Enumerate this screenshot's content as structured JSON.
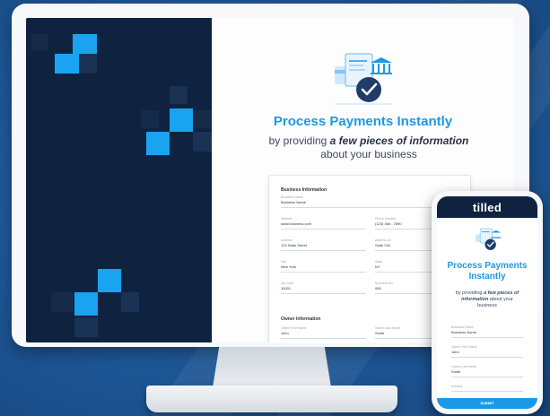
{
  "colors": {
    "accent": "#1a9ae6",
    "brand_dark": "#0f2340",
    "brand_square": "#1aa3f0",
    "background": "#1f5a9c"
  },
  "desktop": {
    "headline": "Process Payments Instantly",
    "sub_prefix": "by providing ",
    "sub_emphasis": "a few pieces of information",
    "sub_suffix": " about your business",
    "icon": "payments-illustration-icon",
    "form": {
      "business_section": "Business Information",
      "owner_section": "Owner Information",
      "fields": [
        {
          "label": "Business Name",
          "value": "Business Name"
        },
        {
          "label": "Website",
          "value": "www.business.com"
        },
        {
          "label": "Phone Number",
          "value": "(123) 456 - 7890"
        },
        {
          "label": "Address",
          "value": "123 State Street"
        },
        {
          "label": "Address #2",
          "value": "Suite 234"
        },
        {
          "label": "City",
          "value": "New York"
        },
        {
          "label": "State",
          "value": "NY"
        },
        {
          "label": "Zip Code",
          "value": "10001"
        },
        {
          "label": "Business Ein",
          "value": "085"
        },
        {
          "label": "Owner First Name",
          "value": "John"
        },
        {
          "label": "Owner Last Name",
          "value": "Smith"
        }
      ]
    }
  },
  "mobile": {
    "logo": "tilled",
    "headline": "Process Payments Instantly",
    "sub_prefix": "by providing ",
    "sub_emphasis": "a few pieces of information",
    "sub_suffix": " about your business",
    "icon": "payments-illustration-icon",
    "fields": [
      {
        "label": "Business Name",
        "value": "Business Name"
      },
      {
        "label": "Owner First Name",
        "value": "John"
      },
      {
        "label": "Owner Last Name",
        "value": "Smith"
      },
      {
        "label": "Industry",
        "value": ""
      }
    ],
    "submit": "SUBMIT"
  }
}
